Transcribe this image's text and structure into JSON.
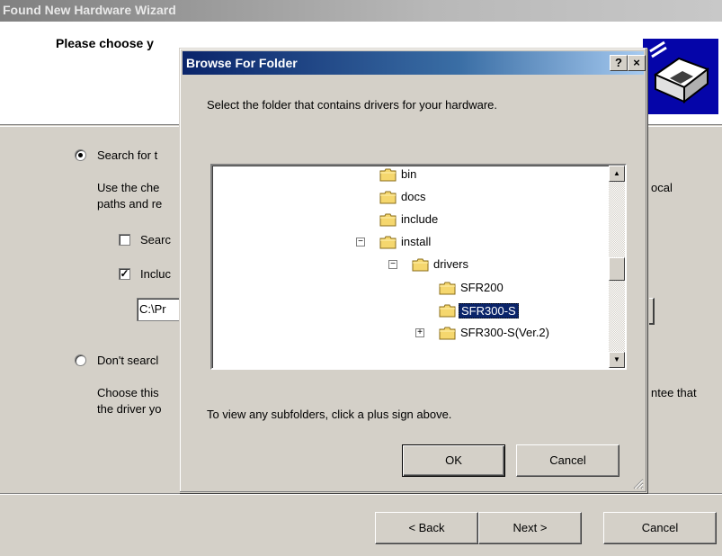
{
  "wizard": {
    "title": "Found New Hardware Wizard",
    "heading": "Please choose y",
    "options": {
      "search_label": "Search for t",
      "search_desc_line1": "Use the che",
      "search_desc_line1_right": "ocal",
      "search_desc_line2": "paths and re",
      "search_removable_label": "Searc",
      "include_location_label": "Incluc",
      "path_value": "C:\\Pr",
      "dont_search_label": "Don't searcl",
      "dont_search_desc_line1": "Choose this",
      "dont_search_desc_line1_right": "ntee that",
      "dont_search_desc_line2": "the driver yo"
    },
    "buttons": {
      "back": "< Back",
      "next": "Next >",
      "cancel": "Cancel"
    }
  },
  "dialog": {
    "title": "Browse For Folder",
    "help_label": "?",
    "close_label": "×",
    "prompt": "Select the folder that contains drivers for your hardware.",
    "hint": "To view any subfolders, click a plus sign above.",
    "ok_label": "OK",
    "cancel_label": "Cancel",
    "tree": [
      {
        "label": "bin",
        "expander": ""
      },
      {
        "label": "docs",
        "expander": ""
      },
      {
        "label": "include",
        "expander": ""
      },
      {
        "label": "install",
        "expander": "−"
      },
      {
        "label": "drivers",
        "expander": "−"
      },
      {
        "label": "SFR200",
        "expander": ""
      },
      {
        "label": "SFR300-S",
        "expander": "",
        "selected": true
      },
      {
        "label": "SFR300-S(Ver.2)",
        "expander": "+"
      }
    ],
    "scroll_up": "▲",
    "scroll_down": "▼"
  }
}
